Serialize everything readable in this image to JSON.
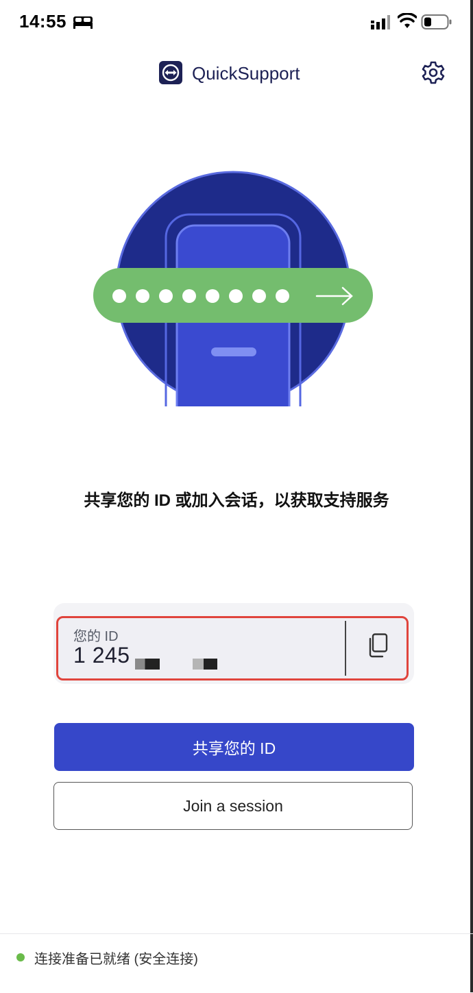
{
  "status_bar": {
    "time": "14:55"
  },
  "header": {
    "title": "QuickSupport"
  },
  "main": {
    "tagline": "共享您的 ID 或加入会话，以获取支持服务",
    "id_card": {
      "label": "您的 ID",
      "value": "1 245"
    },
    "share_button": "共享您的 ID",
    "join_button": "Join a session"
  },
  "footer": {
    "status": "连接准备已就绪 (安全连接)"
  },
  "colors": {
    "brand_navy": "#1d2155",
    "primary_button": "#3647c9",
    "password_bar": "#74bd6e",
    "status_dot": "#6abb4a",
    "highlight": "#e0443c"
  },
  "icons": [
    "bed-icon",
    "signal-icon",
    "wifi-icon",
    "battery-icon",
    "teamviewer-logo-icon",
    "gear-icon",
    "copy-icon",
    "arrow-right-icon"
  ]
}
